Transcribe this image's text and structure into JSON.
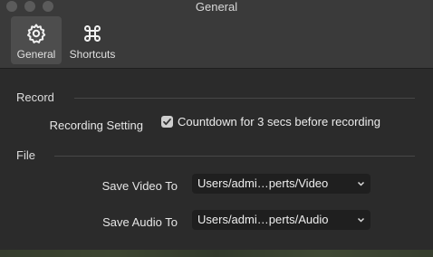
{
  "window": {
    "title": "General"
  },
  "toolbar": {
    "tabs": [
      {
        "label": "General",
        "icon": "gear-icon"
      },
      {
        "label": "Shortcuts",
        "icon": "command-icon"
      }
    ]
  },
  "record": {
    "header": "Record",
    "setting_label": "Recording Setting",
    "countdown_label": "Countdown for 3 secs before recording",
    "countdown_checked": true
  },
  "file": {
    "header": "File",
    "video_label": "Save Video To",
    "video_path": "Users/admi…perts/Video",
    "audio_label": "Save Audio To",
    "audio_path": "Users/admi…perts/Audio"
  },
  "colors": {
    "background": "#2b2b2b",
    "toolbar": "#3a3a3a",
    "select_bg": "#1f1f1f"
  }
}
